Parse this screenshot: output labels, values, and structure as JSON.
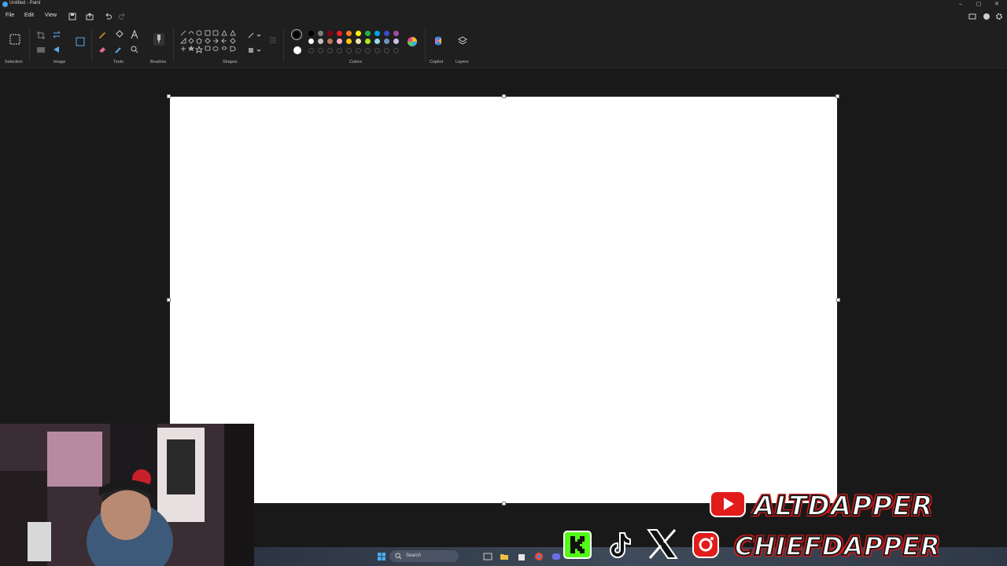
{
  "window": {
    "title": "Untitled - Paint",
    "controls": [
      "–",
      "▢",
      "✕"
    ]
  },
  "menu": {
    "file": "File",
    "edit": "Edit",
    "view": "View"
  },
  "ribbon": {
    "groups": {
      "selection": "Selection",
      "image": "Image",
      "tools": "Tools",
      "brushes": "Brushes",
      "shapes": "Shapes",
      "colors": "Colors",
      "copilot": "Copilot",
      "layers": "Layers"
    },
    "palette_row1": [
      "#000000",
      "#7f7f7f",
      "#880015",
      "#ed1c24",
      "#ff7f27",
      "#fff200",
      "#22b14c",
      "#00a2e8",
      "#3f48cc",
      "#a349a4"
    ],
    "palette_row2": [
      "#ffffff",
      "#c3c3c3",
      "#b97a57",
      "#ffaec9",
      "#ffc90e",
      "#efe4b0",
      "#b5e61d",
      "#99d9ea",
      "#7092be",
      "#c8bfe7"
    ],
    "primary_color": "#000000",
    "secondary_color": "#ffffff"
  },
  "taskbar": {
    "search_placeholder": "Search"
  },
  "overlay": {
    "channel_top": "ALTDAPPER",
    "channel_bottom": "CHIEFDAPPER"
  },
  "colors": {
    "accent_red": "#e21b1b",
    "canvas": "#ffffff",
    "app_bg": "#1b1b1b"
  }
}
